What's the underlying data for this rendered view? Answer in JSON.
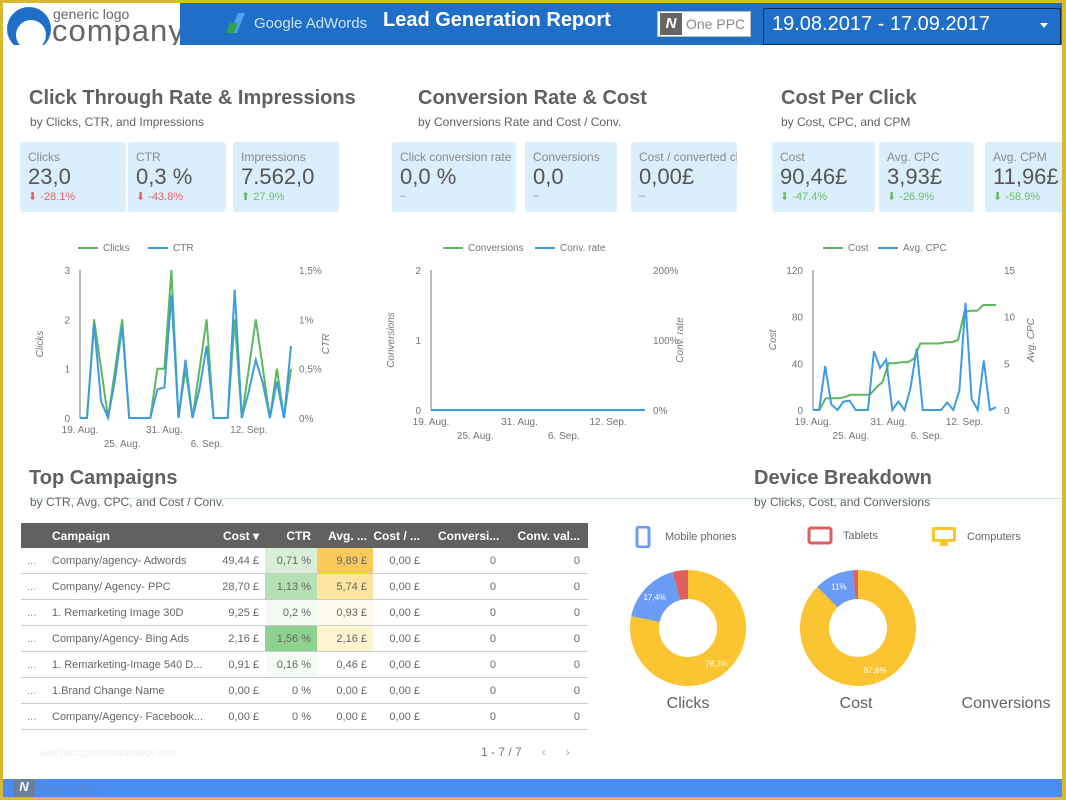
{
  "header": {
    "logo_small": "generic logo",
    "logo_big": "company",
    "adwords_label": "Google AdWords",
    "title": "Lead Generation Report",
    "partner_label": "One PPC",
    "partner_mark": "N",
    "date_range": "19.08.2017 - 17.09.2017"
  },
  "sections": {
    "ctr": {
      "title": "Click Through Rate & Impressions",
      "subtitle": "by Clicks, CTR, and Impressions"
    },
    "conv": {
      "title": "Conversion Rate & Cost",
      "subtitle": "by Conversions Rate and Cost / Conv."
    },
    "cpc": {
      "title": "Cost Per Click",
      "subtitle": "by Cost, CPC, and CPM"
    },
    "campaigns": {
      "title": "Top Campaigns",
      "subtitle": "by CTR, Avg. CPC, and Cost / Conv."
    },
    "devices": {
      "title": "Device Breakdown",
      "subtitle": "by Clicks, Cost, and Conversions"
    }
  },
  "scorecards": [
    {
      "label": "Clicks",
      "value": "23,0",
      "delta": "-28.1%",
      "trend": "down-bad",
      "arrow": "⬇"
    },
    {
      "label": "CTR",
      "value": "0,3 %",
      "delta": "-43.8%",
      "trend": "down-bad",
      "arrow": "⬇"
    },
    {
      "label": "Impressions",
      "value": "7.562,0",
      "delta": "27.9%",
      "trend": "up-good",
      "arrow": "⬆"
    },
    {
      "label": "Click conversion rate",
      "value": "0,0 %",
      "delta": "–",
      "trend": "none",
      "arrow": ""
    },
    {
      "label": "Conversions",
      "value": "0,0",
      "delta": "–",
      "trend": "none",
      "arrow": ""
    },
    {
      "label": "Cost / converted click",
      "value": "0,00£",
      "delta": "–",
      "trend": "none",
      "arrow": ""
    },
    {
      "label": "Cost",
      "value": "90,46£",
      "delta": "-47.4%",
      "trend": "down-good",
      "arrow": "⬇"
    },
    {
      "label": "Avg. CPC",
      "value": "3,93£",
      "delta": "-26.9%",
      "trend": "down-good",
      "arrow": "⬇"
    },
    {
      "label": "Avg. CPM",
      "value": "11,96£",
      "delta": "-58.9%",
      "trend": "down-good",
      "arrow": "⬇"
    }
  ],
  "chart_data": [
    {
      "id": "clicks-ctr",
      "type": "line",
      "x_tick_labels": [
        "19. Aug.",
        "25. Aug.",
        "31. Aug.",
        "6. Sep.",
        "12. Sep."
      ],
      "x_tick_index": [
        0,
        6,
        12,
        18,
        24
      ],
      "ylabel": "Clicks",
      "y2label": "CTR",
      "ylim": [
        0,
        3
      ],
      "y_ticks": [
        "0",
        "1",
        "2",
        "3"
      ],
      "y2lim": [
        0,
        1.5
      ],
      "y2_ticks": [
        "0%",
        "0,5%",
        "1%",
        "1,5%"
      ],
      "series": [
        {
          "name": "Clicks",
          "color": "#5cb85c",
          "axis": "left",
          "values": [
            0,
            0,
            2,
            1,
            0,
            1,
            2,
            0,
            0,
            0,
            0,
            1,
            1,
            3,
            0,
            1,
            0,
            1,
            2,
            0,
            0,
            0,
            2,
            0,
            1,
            2,
            1,
            0,
            1,
            0,
            1
          ]
        },
        {
          "name": "CTR",
          "color": "#3d9de0",
          "axis": "right",
          "values": [
            0,
            0,
            0.95,
            0.17,
            0,
            0.4,
            0.93,
            0,
            0,
            0,
            0,
            0.29,
            0.31,
            1.25,
            0,
            0.59,
            0,
            0.3,
            0.73,
            0,
            0,
            0,
            1.3,
            0,
            0.27,
            0.59,
            0.35,
            0,
            0.37,
            0,
            0.73
          ]
        }
      ]
    },
    {
      "id": "conversions-rate",
      "type": "line",
      "x_tick_labels": [
        "19. Aug.",
        "25. Aug.",
        "31. Aug.",
        "6. Sep.",
        "12. Sep."
      ],
      "x_tick_index": [
        0,
        6,
        12,
        18,
        24
      ],
      "ylabel": "Conversions",
      "y2label": "Conv. rate",
      "ylim": [
        0,
        2
      ],
      "y_ticks": [
        "0",
        "1",
        "2"
      ],
      "y2lim": [
        0,
        200
      ],
      "y2_ticks": [
        "0%",
        "100%",
        "200%"
      ],
      "series": [
        {
          "name": "Conversions",
          "color": "#5cb85c",
          "axis": "left",
          "values": [
            0,
            0,
            0,
            0,
            0,
            0,
            0,
            0,
            0,
            0,
            0,
            0,
            0,
            0,
            0,
            0,
            0,
            0,
            0,
            0,
            0,
            0,
            0,
            0,
            0,
            0,
            0,
            0,
            0,
            0
          ]
        },
        {
          "name": "Conv. rate",
          "color": "#3d9de0",
          "axis": "right",
          "values": [
            0,
            0,
            0,
            0,
            0,
            0,
            0,
            0,
            0,
            0,
            0,
            0,
            0,
            0,
            0,
            0,
            0,
            0,
            0,
            0,
            0,
            0,
            0,
            0,
            0,
            0,
            0,
            0,
            0,
            0
          ]
        }
      ]
    },
    {
      "id": "cost-cpc",
      "type": "line",
      "x_tick_labels": [
        "19. Aug.",
        "25. Aug.",
        "31. Aug.",
        "6. Sep.",
        "12. Sep."
      ],
      "x_tick_index": [
        0,
        6,
        12,
        18,
        24
      ],
      "ylabel": "Cost",
      "y2label": "Avg. CPC",
      "ylim": [
        0,
        120
      ],
      "y_ticks": [
        "0",
        "40",
        "80",
        "120"
      ],
      "y2lim": [
        0,
        15
      ],
      "y2_ticks": [
        "0",
        "5",
        "10",
        "15"
      ],
      "series": [
        {
          "name": "Cost",
          "color": "#5cb85c",
          "axis": "left",
          "values": [
            0,
            0,
            9.9,
            10,
            10,
            11,
            13,
            13,
            13,
            13,
            19,
            24,
            40,
            40,
            41,
            41,
            44,
            57,
            57,
            57,
            57,
            58,
            58,
            60,
            84,
            85,
            85,
            90,
            90,
            90
          ]
        },
        {
          "name": "Avg. CPC",
          "color": "#3d9de0",
          "axis": "right",
          "values": [
            0,
            0,
            4.7,
            0.6,
            0,
            0.9,
            1,
            0,
            0,
            0,
            6.3,
            4.5,
            5.4,
            0,
            0.9,
            0,
            2.4,
            6.6,
            0,
            0,
            0,
            0,
            0.8,
            0,
            2.1,
            11.5,
            1.2,
            0,
            5.3,
            0,
            0.3
          ]
        }
      ]
    },
    {
      "id": "device-clicks",
      "type": "pie",
      "title": "Clicks",
      "labels": [
        "Computers",
        "Mobile phones",
        "Tablets"
      ],
      "values": [
        78.3,
        17.4,
        4.3
      ],
      "value_labels": [
        "78,3%",
        "17,4%",
        ""
      ],
      "colors": [
        "#fbc531",
        "#6a9cf5",
        "#e06060"
      ]
    },
    {
      "id": "device-cost",
      "type": "pie",
      "title": "Cost",
      "labels": [
        "Computers",
        "Mobile phones",
        "Tablets"
      ],
      "values": [
        87.6,
        11.0,
        1.4
      ],
      "value_labels": [
        "87,6%",
        "11%",
        ""
      ],
      "colors": [
        "#fbc531",
        "#6a9cf5",
        "#e06060"
      ]
    },
    {
      "id": "device-conversions",
      "type": "pie",
      "title": "Conversions",
      "labels": [],
      "values": []
    }
  ],
  "table": {
    "headers": [
      "Campaign",
      "Cost ▾",
      "CTR",
      "Avg. ...",
      "Cost / ...",
      "Conversi...",
      "Conv. val..."
    ],
    "rows": [
      {
        "campaign": "Company/agency- Adwords",
        "cost": "49,44 £",
        "ctr": "0,71 %",
        "cpc": "9,89 £",
        "cpconv": "0,00 £",
        "conv": "0",
        "convval": "0",
        "ctr_shade": "#d6efd6",
        "cpc_shade": "#fbc85a"
      },
      {
        "campaign": "Company/ Agency- PPC",
        "cost": "28,70 £",
        "ctr": "1,13 %",
        "cpc": "5,74 £",
        "cpconv": "0,00 £",
        "conv": "0",
        "convval": "0",
        "ctr_shade": "#b4e0b4",
        "cpc_shade": "#fde4a0"
      },
      {
        "campaign": "1. Remarketing Image 30D",
        "cost": "9,25 £",
        "ctr": "0,2 %",
        "cpc": "0,93 £",
        "cpconv": "0,00 £",
        "conv": "0",
        "convval": "0",
        "ctr_shade": "#f3faf3",
        "cpc_shade": "#fffaea"
      },
      {
        "campaign": "Company/Agency- Bing Ads",
        "cost": "2,16 £",
        "ctr": "1,56 %",
        "cpc": "2,16 £",
        "cpconv": "0,00 £",
        "conv": "0",
        "convval": "0",
        "ctr_shade": "#8fd18f",
        "cpc_shade": "#fef4d2"
      },
      {
        "campaign": "1. Remarketing-Image 540 D...",
        "cost": "0,91 £",
        "ctr": "0,16 %",
        "cpc": "0,46 £",
        "cpconv": "0,00 £",
        "conv": "0",
        "convval": "0",
        "ctr_shade": "#f5fbf5",
        "cpc_shade": "#ffffff"
      },
      {
        "campaign": "1.Brand Change Name",
        "cost": "0,00 £",
        "ctr": "0 %",
        "cpc": "0,00 £",
        "cpconv": "0,00 £",
        "conv": "0",
        "convval": "0",
        "ctr_shade": "#ffffff",
        "cpc_shade": "#ffffff"
      },
      {
        "campaign": "Company/Agency- Facebook...",
        "cost": "0,00 £",
        "ctr": "0 %",
        "cpc": "0,00 £",
        "cpconv": "0,00 £",
        "conv": "0",
        "convval": "0",
        "ctr_shade": "#ffffff",
        "cpc_shade": "#ffffff"
      }
    ],
    "row_prefix": "...",
    "pagination": "1 - 7 / 7",
    "prev": "‹",
    "next": "›"
  },
  "devices_legend": [
    {
      "label": "Mobile phones",
      "icon": "mobile-phone-icon",
      "color": "#6a9cf5"
    },
    {
      "label": "Tablets",
      "icon": "tablet-icon",
      "color": "#e06060"
    },
    {
      "label": "Computers",
      "icon": "computer-icon",
      "color": "#fbc531"
    }
  ],
  "footer": {
    "watermark": "www.heritagechristiancollege.com",
    "brand": "One PPC",
    "mark": "N"
  }
}
